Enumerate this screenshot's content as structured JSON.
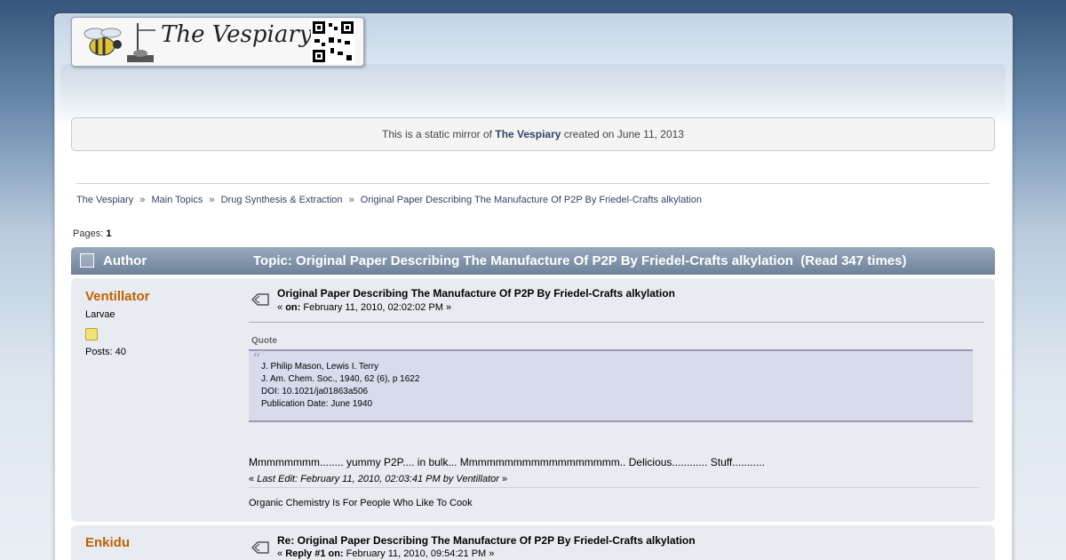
{
  "logo": {
    "text": "The Vespiary"
  },
  "notice": {
    "prefix": "This is a static mirror of",
    "site_link": "The Vespiary",
    "suffix": "created on June 11, 2013"
  },
  "breadcrumb": {
    "items": [
      "The Vespiary",
      "Main Topics",
      "Drug Synthesis & Extraction",
      "Original Paper Describing The Manufacture Of P2P By Friedel-Crafts alkylation"
    ],
    "separator": "»"
  },
  "pagination": {
    "label": "Pages:",
    "current": "1"
  },
  "topic_header": {
    "author_label": "Author",
    "topic_title": "Topic: Original Paper Describing The Manufacture Of P2P By Friedel-Crafts alkylation  (Read 347 times)"
  },
  "posts": [
    {
      "poster_name": "Ventillator",
      "rank": "Larvae",
      "post_count": "Posts: 40",
      "subject": "Original Paper Describing The Manufacture Of P2P By Friedel-Crafts alkylation",
      "meta_prefix": "«",
      "meta_on": "on:",
      "meta_date": "February 11, 2010, 02:02:02 PM »",
      "quote_label": "Quote",
      "quote_lines": [
        "J. Philip Mason, Lewis I. Terry",
        "J. Am. Chem. Soc., 1940, 62 (6), p 1622",
        "DOI: 10.1021/ja01863a506",
        "Publication Date: June 1940"
      ],
      "body": "Mmmmmmmm........ yummy P2P.... in bulk... Mmmmmmmmmmmmmmmmmm.. Delicious............ Stuff...........",
      "last_edit_prefix": "«",
      "last_edit": "Last Edit: February 11, 2010, 02:03:41 PM by Ventillator",
      "last_edit_suffix": "»",
      "signature": "Organic Chemistry Is For People Who Like To Cook"
    },
    {
      "poster_name": "Enkidu",
      "subject": "Re: Original Paper Describing The Manufacture Of P2P By Friedel-Crafts alkylation",
      "meta_prefix": "«",
      "meta_on": "Reply #1 on:",
      "meta_date": "February 11, 2010, 09:54:21 PM »"
    }
  ],
  "colors": {
    "poster_name": "#c06002",
    "header_bar": "#7d91a8",
    "post_bg": "#e8ecf1",
    "quote_bg": "#d7dbec",
    "link": "#334466"
  }
}
